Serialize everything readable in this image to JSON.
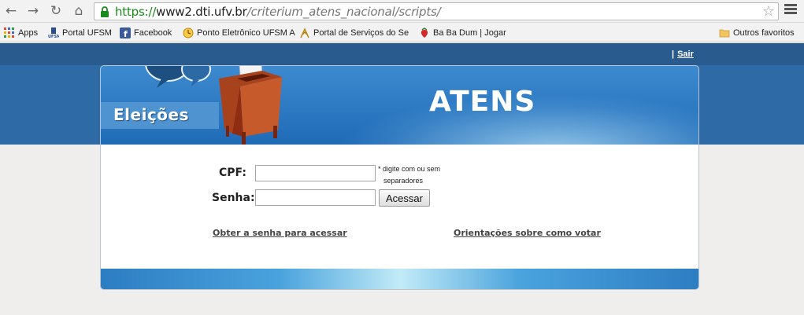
{
  "browser": {
    "url_scheme": "https://",
    "url_host": "www2.dti.ufv.br",
    "url_path": "/criterium_atens_nacional/scripts/"
  },
  "bookmarks": {
    "apps": "Apps",
    "items": [
      "Portal UFSM",
      "Facebook",
      "Ponto Eletrônico UFSM A",
      "Portal de Serviços do Se",
      "Ba Ba Dum | Jogar"
    ],
    "others": "Outros favoritos"
  },
  "header": {
    "separator": "|",
    "logout": "Sair"
  },
  "banner": {
    "eleicoes": "Eleições",
    "title": "ATENS"
  },
  "login": {
    "cpf_label": "CPF:",
    "cpf_value": "",
    "cpf_hint_line1": "* digite com ou sem",
    "cpf_hint_line2": "separadores",
    "senha_label": "Senha:",
    "senha_value": "",
    "submit_label": "Acessar"
  },
  "links": {
    "get_password": "Obter a senha para acessar",
    "voting_guide": "Orientações sobre como votar"
  },
  "colors": {
    "topbar": "#2a5b8f",
    "band": "#2d6aa6",
    "url_green": "#1a8a1a"
  }
}
